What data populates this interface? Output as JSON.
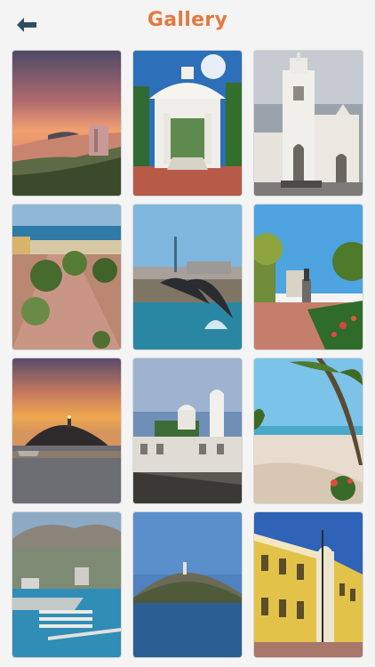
{
  "header": {
    "title": "Gallery",
    "back_icon": "arrow-left-icon"
  },
  "colors": {
    "title": "#e27a3f",
    "back_arrow": "#2f4f5f",
    "background": "#f4f4f4"
  },
  "gallery": {
    "items": [
      {
        "name": "photo-sunset-coast-city"
      },
      {
        "name": "photo-white-kiosk"
      },
      {
        "name": "photo-white-cathedral"
      },
      {
        "name": "photo-promenade-beach"
      },
      {
        "name": "photo-dolphin-statue"
      },
      {
        "name": "photo-park-statue"
      },
      {
        "name": "photo-island-lighthouse-sunset"
      },
      {
        "name": "photo-white-buildings-domes"
      },
      {
        "name": "photo-palm-beach"
      },
      {
        "name": "photo-marina-aerial"
      },
      {
        "name": "photo-rocky-island-lighthouse"
      },
      {
        "name": "photo-yellow-colonial-building"
      }
    ]
  }
}
